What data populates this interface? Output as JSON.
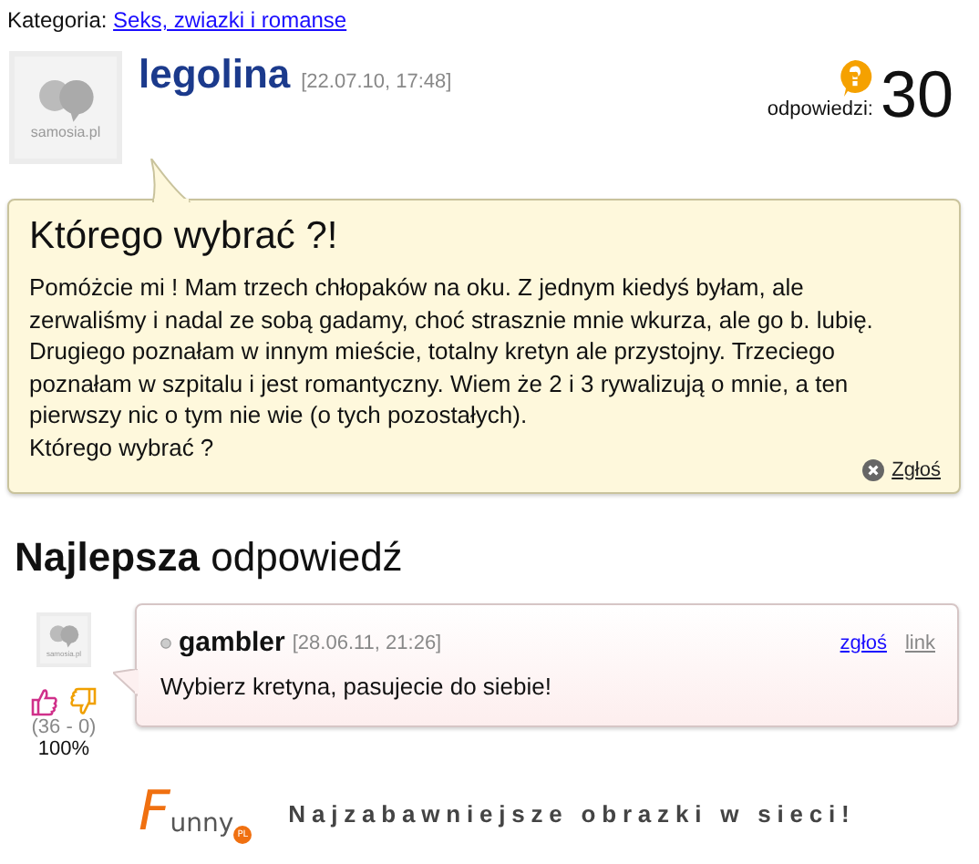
{
  "category": {
    "label": "Kategoria:",
    "link": "Seks, zwiazki i romanse"
  },
  "question": {
    "avatar_label": "samosia.pl",
    "author": "legolina",
    "date": "[22.07.10, 17:48]",
    "answers_label": "odpowiedzi:",
    "answers_count": "30",
    "title": "Którego wybrać ?!",
    "body": [
      "Pomóżcie mi ! Mam trzech chłopaków na oku. Z jednym kiedyś byłam, ale zerwaliśmy i nadal ze sobą gadamy, choć strasznie mnie wkurza, ale go b. lubię. Drugiego poznałam w innym mieście, totalny kretyn ale przystojny. Trzeciego poznałam w szpitalu i jest romantyczny. Wiem że 2 i 3 rywalizują o mnie, a ten pierwszy nic o tym nie wie (o tych pozostałych).",
      "Którego wybrać ?"
    ],
    "report": "Zgłoś"
  },
  "best_answer": {
    "heading": "**Najlepsza** odpowiedź",
    "avatar_label": "samosia.pl",
    "votes": "(36 - 0)",
    "percent": "100%",
    "author": "gambler",
    "date": "[28.06.11, 21:26]",
    "report": "zgłoś",
    "link": "link",
    "text": "Wybierz kretyna, pasujecie do siebie!"
  },
  "banner": {
    "logo_initial": "F",
    "logo_rest": "unny",
    "logo_suffix": "PL",
    "tagline": "Najzabawniejsze obrazki w sieci!"
  }
}
